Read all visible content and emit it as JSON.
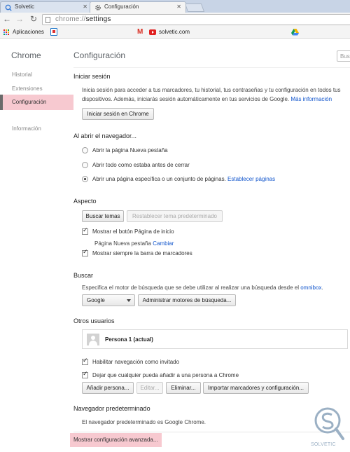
{
  "tabs": [
    {
      "label": "Solvetic",
      "active": false
    },
    {
      "label": "Configuración",
      "active": true
    }
  ],
  "toolbar": {
    "url_scheme": "chrome://",
    "url_path": "settings"
  },
  "bookmarks": {
    "apps_label": "Aplicaciones",
    "solvetic_label": "solvetic.com",
    "gmail_glyph": "M"
  },
  "sidebar": {
    "title": "Chrome",
    "items": [
      {
        "label": "Historial",
        "selected": false
      },
      {
        "label": "Extensiones",
        "selected": false
      },
      {
        "label": "Configuración",
        "selected": true
      },
      {
        "label": "Información",
        "selected": false
      }
    ]
  },
  "main": {
    "title": "Configuración",
    "search_placeholder": "Buscar",
    "signin": {
      "title": "Iniciar sesión",
      "line1": "Inicia sesión para acceder a tus marcadores, tu historial, tus contraseñas y tu configuración en todos tus",
      "line2": "dispositivos. Además, iniciarás sesión automáticamente en tus servicios de Google.",
      "more_info_link": "Más información",
      "button": "Iniciar sesión en Chrome"
    },
    "startup": {
      "title": "Al abrir el navegador...",
      "options": [
        "Abrir la página Nueva pestaña",
        "Abrir todo como estaba antes de cerrar",
        "Abrir una página específica o un conjunto de páginas."
      ],
      "selected_index": 2,
      "set_pages_link": "Establecer páginas"
    },
    "appearance": {
      "title": "Aspecto",
      "get_themes_button": "Buscar temas",
      "reset_theme_button": "Restablecer tema predeterminado",
      "show_home_label": "Mostrar el botón Página de inicio",
      "home_page_text": "Página Nueva pestaña",
      "change_link": "Cambiar",
      "show_bookmarks_label": "Mostrar siempre la barra de marcadores"
    },
    "search": {
      "title": "Buscar",
      "description": "Especifica el motor de búsqueda que se debe utilizar al realizar una búsqueda desde el",
      "omnibox_link": "omnibox",
      "description_end": ".",
      "engine_selected": "Google",
      "manage_button": "Administrar motores de búsqueda..."
    },
    "people": {
      "title": "Otros usuarios",
      "user_name": "Persona 1 (actual)",
      "guest_label": "Habilitar navegación como invitado",
      "anyone_label": "Dejar que cualquier pueda añadir a una persona a Chrome",
      "add_button": "Añadir persona...",
      "edit_button": "Editar...",
      "delete_button": "Eliminar...",
      "import_button": "Importar marcadores y configuración..."
    },
    "default_browser": {
      "title": "Navegador predeterminado",
      "text": "El navegador predeterminado es Google Chrome."
    },
    "advanced_link": "Mostrar configuración avanzada..."
  },
  "watermark": {
    "text": "SOLVETIC",
    "color": "#9bb0c4"
  },
  "colors": {
    "highlight": "#f7c9d0",
    "link": "#1155cc",
    "tabstrip": "#c8d4e6"
  }
}
